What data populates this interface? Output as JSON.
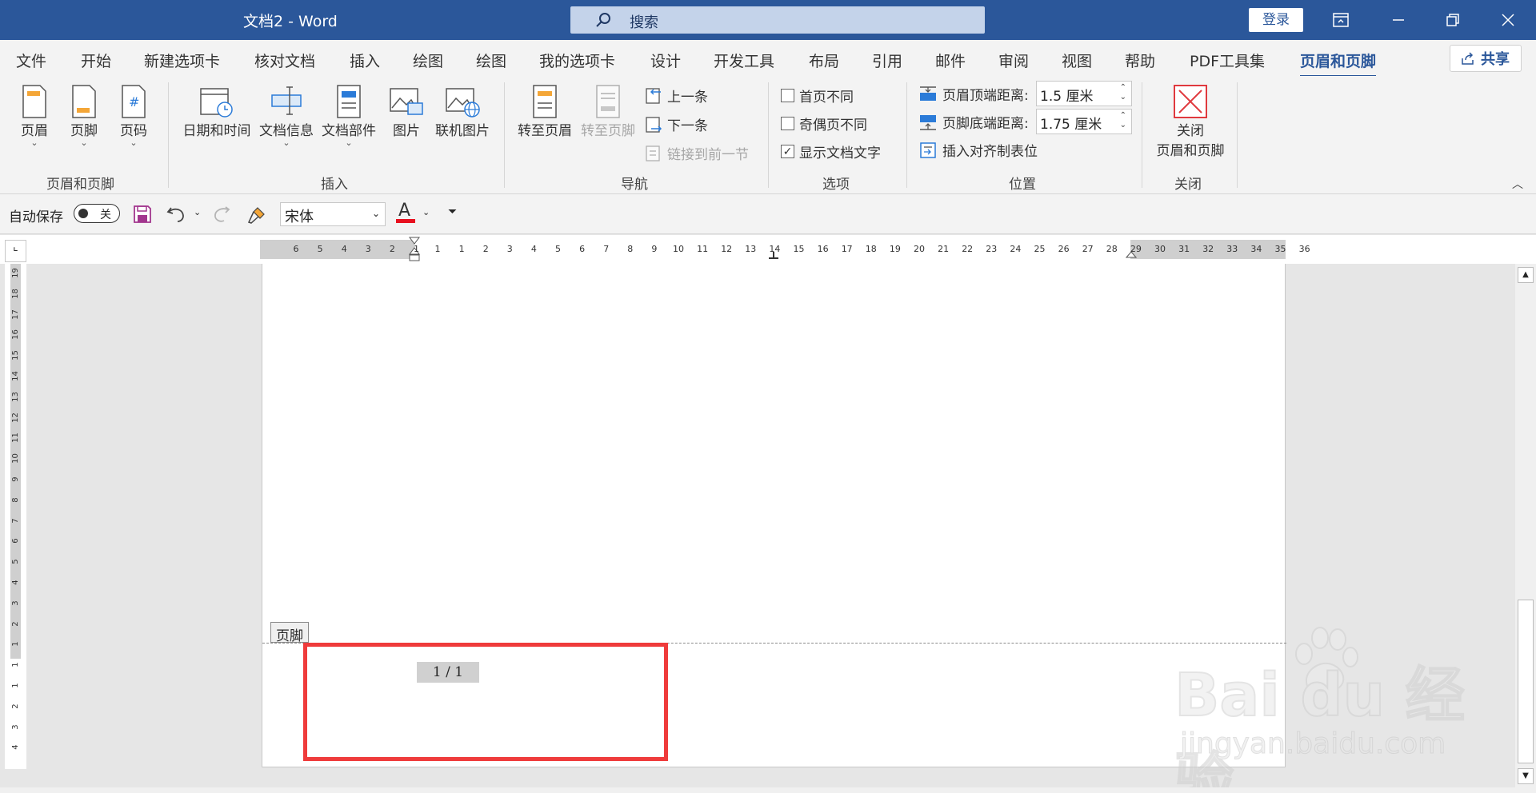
{
  "titlebar": {
    "doc_name": "文档2  -  Word",
    "search_placeholder": "搜索",
    "login_label": "登录"
  },
  "tabs": [
    {
      "label": "文件"
    },
    {
      "label": "开始"
    },
    {
      "label": "新建选项卡"
    },
    {
      "label": "核对文档"
    },
    {
      "label": "插入"
    },
    {
      "label": "绘图"
    },
    {
      "label": "绘图"
    },
    {
      "label": "我的选项卡"
    },
    {
      "label": "设计"
    },
    {
      "label": "开发工具"
    },
    {
      "label": "布局"
    },
    {
      "label": "引用"
    },
    {
      "label": "邮件"
    },
    {
      "label": "审阅"
    },
    {
      "label": "视图"
    },
    {
      "label": "帮助"
    },
    {
      "label": "PDF工具集"
    },
    {
      "label": "页眉和页脚"
    }
  ],
  "active_tab": "页眉和页脚",
  "share_label": "共享",
  "ribbon": {
    "hf_group": {
      "label": "页眉和页脚",
      "header_btn": "页眉",
      "footer_btn": "页脚",
      "pagenum_btn": "页码"
    },
    "insert_group": {
      "label": "插入",
      "datetime_btn": "日期和时间",
      "docinfo_btn": "文档信息",
      "docparts_btn": "文档部件",
      "picture_btn": "图片",
      "online_picture_btn": "联机图片"
    },
    "nav_group": {
      "label": "导航",
      "goto_header": "转至页眉",
      "goto_footer": "转至页脚",
      "prev": "上一条",
      "next": "下一条",
      "link_prev": "链接到前一节"
    },
    "options_group": {
      "label": "选项",
      "diff_first": "首页不同",
      "diff_odd_even": "奇偶页不同",
      "show_doc_text": "显示文档文字",
      "show_doc_text_checked": true
    },
    "position_group": {
      "label": "位置",
      "header_top_label": "页眉顶端距离:",
      "header_top_value": "1.5 厘米",
      "footer_bottom_label": "页脚底端距离:",
      "footer_bottom_value": "1.75 厘米",
      "insert_align_tab": "插入对齐制表位"
    },
    "close_group": {
      "label": "关闭",
      "close_btn_line1": "关闭",
      "close_btn_line2": "页眉和页脚"
    }
  },
  "qat": {
    "autosave_label": "自动保存",
    "autosave_state": "关",
    "font_name": "宋体",
    "font_color": "#e8101f"
  },
  "ruler": {
    "h_numbers": [
      "6",
      "5",
      "4",
      "3",
      "2",
      "1",
      "1",
      "1",
      "2",
      "3",
      "4",
      "5",
      "6",
      "7",
      "8",
      "9",
      "10",
      "11",
      "12",
      "13",
      "14",
      "15",
      "16",
      "17",
      "18",
      "19",
      "20",
      "21",
      "22",
      "23",
      "24",
      "25",
      "26",
      "27",
      "28",
      "29",
      "30",
      "31",
      "32",
      "33",
      "34",
      "35",
      "36"
    ],
    "v_numbers": [
      "19",
      "18",
      "17",
      "16",
      "15",
      "14",
      "13",
      "12",
      "11",
      "10",
      "9",
      "8",
      "7",
      "6",
      "5",
      "4",
      "3",
      "2",
      "1",
      "1",
      "1",
      "2",
      "3",
      "4"
    ]
  },
  "document": {
    "footer_tag": "页脚",
    "page_number": "1  /  1"
  },
  "watermark": {
    "brand": "Bai du 经验",
    "url": "jingyan.baidu.com"
  },
  "colors": {
    "title_bar": "#2b579a",
    "accent": "#2b579a",
    "highlight": "#ef3b3b"
  }
}
